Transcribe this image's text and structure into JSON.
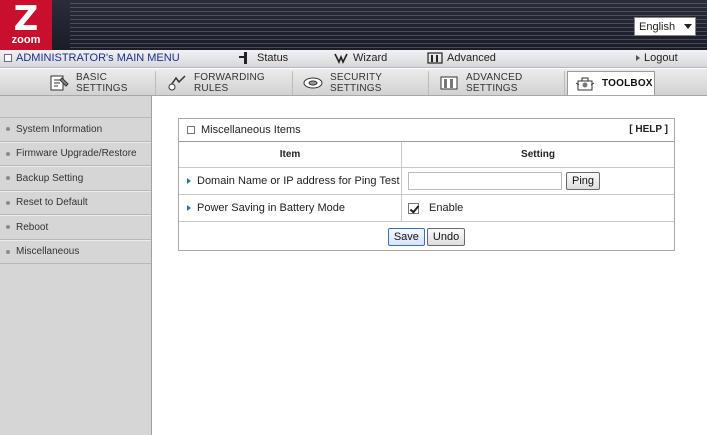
{
  "header": {
    "logo_text": "zoom",
    "language": {
      "selected": "English"
    }
  },
  "menubar": {
    "title": "ADMINISTRATOR's MAIN MENU",
    "status": "Status",
    "wizard": "Wizard",
    "advanced": "Advanced",
    "logout": "Logout"
  },
  "tabs": [
    {
      "label": "BASIC SETTINGS",
      "icon": "basic-settings-icon"
    },
    {
      "label": "FORWARDING RULES",
      "icon": "forwarding-rules-icon"
    },
    {
      "label": "SECURITY SETTINGS",
      "icon": "security-settings-icon"
    },
    {
      "label": "ADVANCED SETTINGS",
      "icon": "advanced-settings-icon"
    },
    {
      "label": "TOOLBOX",
      "icon": "toolbox-icon",
      "active": true
    }
  ],
  "sidebar": {
    "items": [
      {
        "label": "System Information"
      },
      {
        "label": "Firmware Upgrade/Restore"
      },
      {
        "label": "Backup Setting"
      },
      {
        "label": "Reset to Default"
      },
      {
        "label": "Reboot"
      },
      {
        "label": "Miscellaneous"
      }
    ]
  },
  "panel": {
    "title": "Miscellaneous Items",
    "help": "[ HELP ]",
    "col_item": "Item",
    "col_setting": "Setting",
    "rows": [
      {
        "label": "Domain Name or IP address for Ping Test",
        "input_value": "",
        "button": "Ping"
      },
      {
        "label": "Power Saving in Battery Mode",
        "checkbox_label": "Enable",
        "checked": true
      }
    ],
    "save": "Save",
    "undo": "Undo"
  },
  "colors": {
    "brand_red": "#c8102e",
    "menu_title_blue": "#1a2f8a",
    "arrow_teal": "#2a7a9a"
  }
}
